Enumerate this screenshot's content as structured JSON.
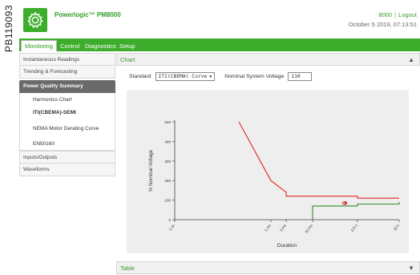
{
  "side_code": "PB119093",
  "header": {
    "app_title": "Powerlogic™ PM8000",
    "device": "8000",
    "separator": "|",
    "logout": "Logout",
    "datetime": "October 5 2019, 07:13:51",
    "brand_color": "#3dae2b"
  },
  "nav": {
    "tabs": [
      {
        "label": "Monitoring",
        "active": true
      },
      {
        "label": "Control",
        "active": false
      },
      {
        "label": "Diagnostics",
        "active": false
      },
      {
        "label": "Setup",
        "active": false
      }
    ]
  },
  "sidebar": {
    "items_top": [
      "Instantaneous Readings",
      "Trending & Forecasting"
    ],
    "section": "Power Quality Summary",
    "sub_items": [
      "Harmonics Chart",
      "ITI(CBEMA)-SEMI",
      "NEMA Motor Derating Curve",
      "EN50160"
    ],
    "items_bottom": [
      "Inputs/Outputs",
      "Waveforms"
    ]
  },
  "chart_panel": {
    "title": "Chart",
    "collapse_icon": "chevron-up-icon",
    "standard_label": "Standard",
    "standard_value": "ITI(CBEMA) Curve",
    "voltage_label": "Nominal System Voltage",
    "voltage_value": "110"
  },
  "table_panel": {
    "title": "Table",
    "expand_icon": "chevron-down-icon"
  },
  "chart_data": {
    "type": "line",
    "xlabel": "Duration",
    "ylabel": "% Nominal Voltage",
    "x_ticks": [
      "1 us",
      "1 ms",
      "3 ms",
      "20 ms",
      "0.5 s",
      "10 s"
    ],
    "y_ticks": [
      "0",
      "100",
      "200",
      "300",
      "400",
      "500"
    ],
    "ylim": [
      0,
      500
    ],
    "series": [
      {
        "color": "#e02b20",
        "points": [
          {
            "x": "0.1 ms",
            "y": 500
          },
          {
            "x": "1 ms",
            "y": 200
          },
          {
            "x": "3 ms",
            "y": 140
          },
          {
            "x": "3 ms",
            "y": 120
          },
          {
            "x": "0.5 s",
            "y": 120
          },
          {
            "x": "0.5 s",
            "y": 110
          },
          {
            "x": "10 s",
            "y": 110
          }
        ]
      },
      {
        "color": "#2e8b2e",
        "points": [
          {
            "x": "20 ms",
            "y": 0
          },
          {
            "x": "20 ms",
            "y": 70
          },
          {
            "x": "0.5 s",
            "y": 70
          },
          {
            "x": "0.5 s",
            "y": 80
          },
          {
            "x": "10 s",
            "y": 80
          },
          {
            "x": "10 s",
            "y": 90
          }
        ]
      }
    ],
    "events": [
      {
        "x": "0.2 s",
        "y": 85,
        "color": "#e02b20"
      }
    ],
    "grid": false,
    "legend": "none"
  }
}
